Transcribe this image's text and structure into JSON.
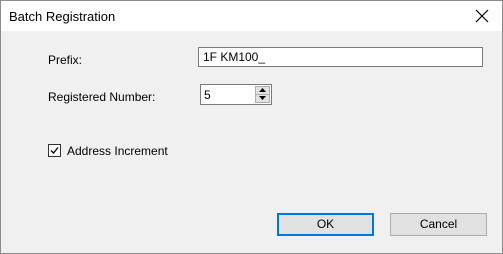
{
  "window": {
    "title": "Batch Registration"
  },
  "form": {
    "prefix_label": "Prefix:",
    "prefix_value": "1F KM100_",
    "registered_number_label": "Registered Number:",
    "registered_number_value": "5",
    "address_increment_label": "Address Increment",
    "address_increment_checked": true
  },
  "buttons": {
    "ok_label": "OK",
    "cancel_label": "Cancel"
  },
  "icons": {
    "close": "close-icon",
    "spin_up": "caret-up-icon",
    "spin_down": "caret-down-icon",
    "check": "checkmark-icon"
  },
  "colors": {
    "dialog_background": "#f0f0f0",
    "focus_border": "#0078d7"
  }
}
